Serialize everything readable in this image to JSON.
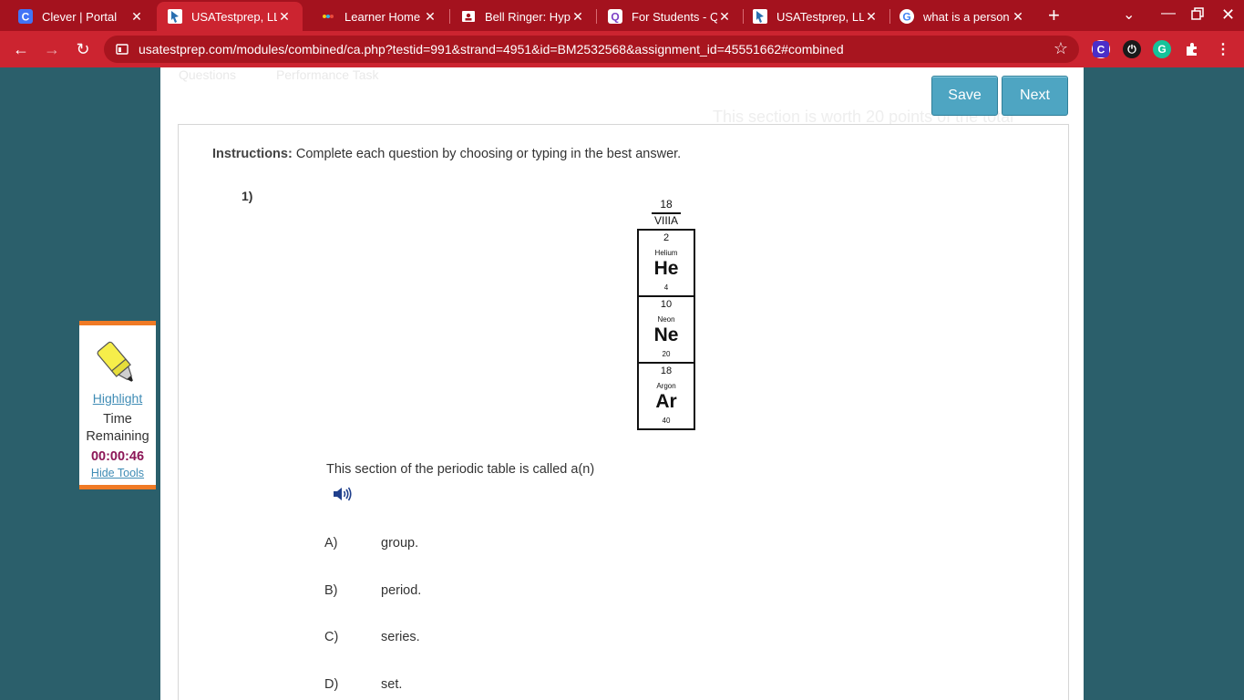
{
  "browser": {
    "tabs": [
      {
        "title": "Clever | Portal",
        "icon": "clever-icon",
        "active": false
      },
      {
        "title": "USATestprep, LLC",
        "icon": "usatestprep-icon",
        "active": true
      },
      {
        "title": "Learner Home",
        "icon": "learner-icon",
        "active": false
      },
      {
        "title": "Bell Ringer: Hype",
        "icon": "classroom-icon",
        "active": false
      },
      {
        "title": "For Students - Q",
        "icon": "quizizz-icon",
        "active": false
      },
      {
        "title": "USATestprep, LLC",
        "icon": "usatestprep-icon",
        "active": false
      },
      {
        "title": "what is a person",
        "icon": "google-icon",
        "active": false
      }
    ],
    "new_tab": "+",
    "url": "usatestprep.com/modules/combined/ca.php?testid=991&strand=4951&id=BM2532568&assignment_id=45551662#combined",
    "colors": {
      "chrome": "#cc2430",
      "tabstrip": "#a4121e"
    }
  },
  "page": {
    "faded_tabs": [
      "Questions",
      "Performance Task"
    ],
    "faded_notice": "This section is worth 20 points of the total",
    "save_label": "Save",
    "next_label": "Next",
    "instructions_label": "Instructions:",
    "instructions_text": " Complete each question by choosing or typing in the best answer.",
    "question_number": "1)",
    "periodic": {
      "group_number": "18",
      "group_roman": "VIIIA",
      "elements": [
        {
          "number": "2",
          "name": "Helium",
          "symbol": "He",
          "mass": "4"
        },
        {
          "number": "10",
          "name": "Neon",
          "symbol": "Ne",
          "mass": "20"
        },
        {
          "number": "18",
          "name": "Argon",
          "symbol": "Ar",
          "mass": "40"
        }
      ]
    },
    "question_text": "This section of the periodic table is called a(n)",
    "choices": [
      {
        "label": "A)",
        "text": "group."
      },
      {
        "label": "B)",
        "text": "period."
      },
      {
        "label": "C)",
        "text": "series."
      },
      {
        "label": "D)",
        "text": "set."
      }
    ],
    "colors": {
      "background": "#2b5f6b",
      "button": "#4ea5c2",
      "accent": "#f07a25",
      "timer": "#8c1657"
    }
  },
  "tools": {
    "highlight_label": "Highlight",
    "time_label": "Time Remaining",
    "timer": "00:00:46",
    "hide_label": "Hide Tools"
  }
}
